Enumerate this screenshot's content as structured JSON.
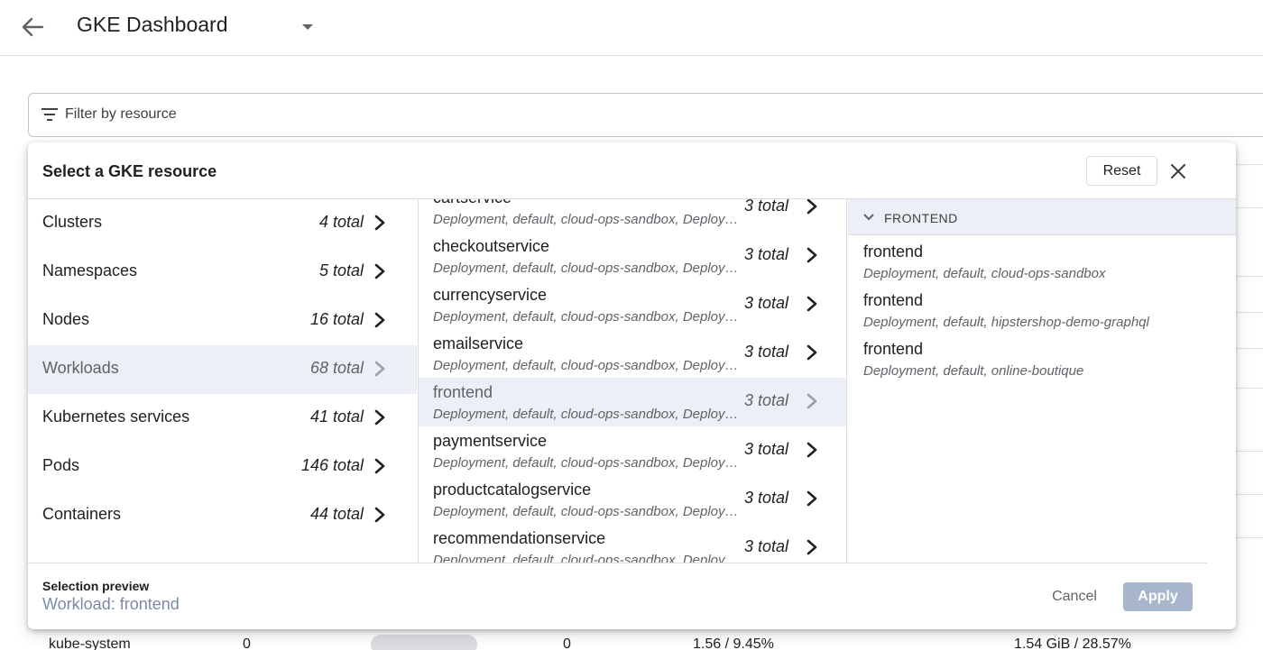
{
  "header": {
    "title": "GKE Dashboard",
    "back_icon": "arrow-back-icon",
    "dropdown_icon": "caret-down-icon"
  },
  "filter": {
    "placeholder": "Filter by resource",
    "icon": "filter-list-icon"
  },
  "modal": {
    "title": "Select a GKE resource",
    "reset_label": "Reset",
    "close_icon": "close-icon",
    "resource_types": [
      {
        "label": "Clusters",
        "count": "4 total"
      },
      {
        "label": "Namespaces",
        "count": "5 total"
      },
      {
        "label": "Nodes",
        "count": "16 total"
      },
      {
        "label": "Workloads",
        "count": "68 total",
        "selected": true
      },
      {
        "label": "Kubernetes services",
        "count": "41 total"
      },
      {
        "label": "Pods",
        "count": "146 total"
      },
      {
        "label": "Containers",
        "count": "44 total"
      }
    ],
    "workloads": [
      {
        "name": "cartservice",
        "desc": "Deployment, default, cloud-ops-sandbox, Deployment",
        "count": "3 total"
      },
      {
        "name": "checkoutservice",
        "desc": "Deployment, default, cloud-ops-sandbox, Deployment",
        "count": "3 total"
      },
      {
        "name": "currencyservice",
        "desc": "Deployment, default, cloud-ops-sandbox, Deployment",
        "count": "3 total"
      },
      {
        "name": "emailservice",
        "desc": "Deployment, default, cloud-ops-sandbox, Deployment",
        "count": "3 total"
      },
      {
        "name": "frontend",
        "desc": "Deployment, default, cloud-ops-sandbox, Deployment",
        "count": "3 total",
        "selected": true
      },
      {
        "name": "paymentservice",
        "desc": "Deployment, default, cloud-ops-sandbox, Deployment",
        "count": "3 total"
      },
      {
        "name": "productcatalogservice",
        "desc": "Deployment, default, cloud-ops-sandbox, Deployment",
        "count": "3 total"
      },
      {
        "name": "recommendationservice",
        "desc": "Deployment, default, cloud-ops-sandbox, Deployment",
        "count": "3 total"
      }
    ],
    "group_header": "FRONTEND",
    "frontend_items": [
      {
        "name": "frontend",
        "desc": "Deployment, default, cloud-ops-sandbox"
      },
      {
        "name": "frontend",
        "desc": "Deployment, default, hipstershop-demo-graphql"
      },
      {
        "name": "frontend",
        "desc": "Deployment, default, online-boutique"
      }
    ],
    "preview_label": "Selection preview",
    "preview_value": "Workload: frontend",
    "cancel_label": "Cancel",
    "apply_label": "Apply"
  },
  "background_row": {
    "namespace": "kube-system",
    "col_a": "0",
    "col_b": "0",
    "cpu": "1.56 / 9.45%",
    "memory": "1.54 GiB / 28.57%"
  },
  "colors": {
    "selected_bg": "#eceff5",
    "apply_disabled_bg": "#a8b6cd",
    "preview_text": "#7a8aa6"
  }
}
